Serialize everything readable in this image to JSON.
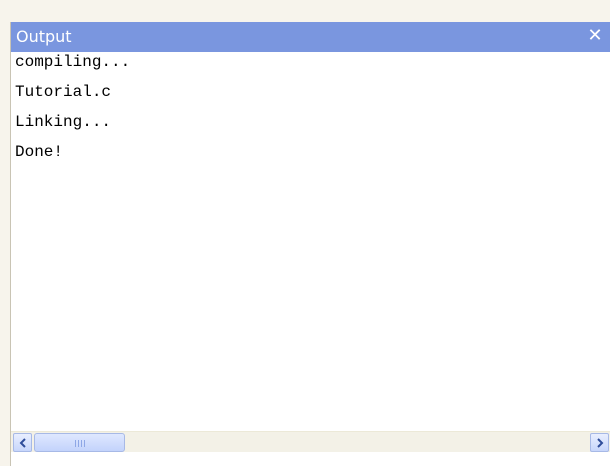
{
  "panel": {
    "title": "Output",
    "close_glyph": "✕"
  },
  "output": {
    "lines": [
      "compiling...",
      "Tutorial.c",
      "Linking...",
      "Done!"
    ]
  },
  "scrollbar": {
    "left_arrow_icon": "chevron-left-icon",
    "right_arrow_icon": "chevron-right-icon",
    "thumb_grip_icon": "grip-icon"
  },
  "colors": {
    "titlebar": "#7a96df",
    "title_text": "#ffffff",
    "content_bg": "#ffffff",
    "scrollbar_bg": "#f3f1e7"
  }
}
